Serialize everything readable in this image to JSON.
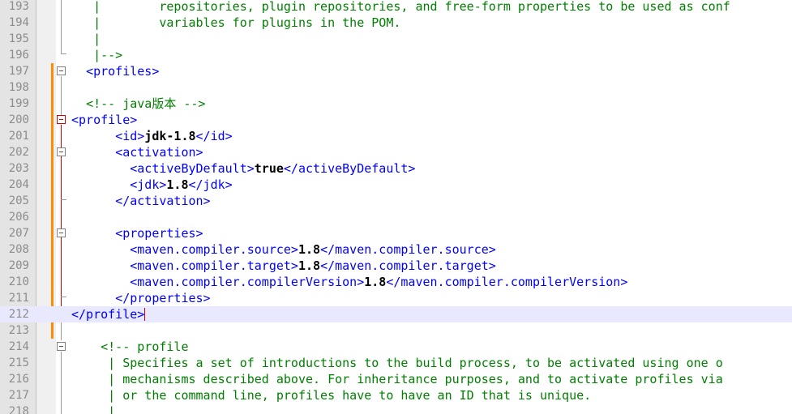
{
  "editor": {
    "lines": [
      {
        "n": "193",
        "segs": [
          {
            "t": "   |        ",
            "c": "cmt"
          },
          {
            "t": "repositories, plugin repositories, and free-form properties to be used as conf",
            "c": "cmt"
          }
        ]
      },
      {
        "n": "194",
        "segs": [
          {
            "t": "   |        ",
            "c": "cmt"
          },
          {
            "t": "variables for plugins in the POM.",
            "c": "cmt"
          }
        ]
      },
      {
        "n": "195",
        "segs": [
          {
            "t": "   |",
            "c": "cmt"
          }
        ]
      },
      {
        "n": "196",
        "segs": [
          {
            "t": "   |-->",
            "c": "cmt"
          }
        ]
      },
      {
        "n": "197",
        "segs": [
          {
            "t": "  ",
            "c": ""
          },
          {
            "t": "<profiles>",
            "c": "tag"
          }
        ]
      },
      {
        "n": "198",
        "segs": []
      },
      {
        "n": "199",
        "segs": [
          {
            "t": "  ",
            "c": ""
          },
          {
            "t": "<!-- java版本 -->",
            "c": "cmt"
          }
        ]
      },
      {
        "n": "200",
        "segs": [
          {
            "t": "<profile>",
            "c": "tag"
          }
        ]
      },
      {
        "n": "201",
        "segs": [
          {
            "t": "      ",
            "c": ""
          },
          {
            "t": "<id>",
            "c": "tag"
          },
          {
            "t": "jdk-1.8",
            "c": "txt"
          },
          {
            "t": "</id>",
            "c": "tag"
          }
        ]
      },
      {
        "n": "202",
        "segs": [
          {
            "t": "      ",
            "c": ""
          },
          {
            "t": "<activation>",
            "c": "tag"
          }
        ]
      },
      {
        "n": "203",
        "segs": [
          {
            "t": "        ",
            "c": ""
          },
          {
            "t": "<activeByDefault>",
            "c": "tag"
          },
          {
            "t": "true",
            "c": "txt"
          },
          {
            "t": "</activeByDefault>",
            "c": "tag"
          }
        ]
      },
      {
        "n": "204",
        "segs": [
          {
            "t": "        ",
            "c": ""
          },
          {
            "t": "<jdk>",
            "c": "tag"
          },
          {
            "t": "1.8",
            "c": "txt"
          },
          {
            "t": "</jdk>",
            "c": "tag"
          }
        ]
      },
      {
        "n": "205",
        "segs": [
          {
            "t": "      ",
            "c": ""
          },
          {
            "t": "</activation>",
            "c": "tag"
          }
        ]
      },
      {
        "n": "206",
        "segs": []
      },
      {
        "n": "207",
        "segs": [
          {
            "t": "      ",
            "c": ""
          },
          {
            "t": "<properties>",
            "c": "tag"
          }
        ]
      },
      {
        "n": "208",
        "segs": [
          {
            "t": "        ",
            "c": ""
          },
          {
            "t": "<maven.compiler.source>",
            "c": "tag"
          },
          {
            "t": "1.8",
            "c": "txt"
          },
          {
            "t": "</maven.compiler.source>",
            "c": "tag"
          }
        ]
      },
      {
        "n": "209",
        "segs": [
          {
            "t": "        ",
            "c": ""
          },
          {
            "t": "<maven.compiler.target>",
            "c": "tag"
          },
          {
            "t": "1.8",
            "c": "txt"
          },
          {
            "t": "</maven.compiler.target>",
            "c": "tag"
          }
        ]
      },
      {
        "n": "210",
        "segs": [
          {
            "t": "        ",
            "c": ""
          },
          {
            "t": "<maven.compiler.compilerVersion>",
            "c": "tag"
          },
          {
            "t": "1.8",
            "c": "txt"
          },
          {
            "t": "</maven.compiler.compilerVersion>",
            "c": "tag"
          }
        ]
      },
      {
        "n": "211",
        "segs": [
          {
            "t": "      ",
            "c": ""
          },
          {
            "t": "</properties>",
            "c": "tag"
          }
        ]
      },
      {
        "n": "212",
        "segs": [
          {
            "t": "</profile>",
            "c": "tag"
          }
        ],
        "current": true
      },
      {
        "n": "213",
        "segs": []
      },
      {
        "n": "214",
        "segs": [
          {
            "t": "    ",
            "c": ""
          },
          {
            "t": "<!-- profile",
            "c": "cmt"
          }
        ]
      },
      {
        "n": "215",
        "segs": [
          {
            "t": "     | Specifies a set of introductions to the build process, to be activated using one o",
            "c": "cmt"
          }
        ]
      },
      {
        "n": "216",
        "segs": [
          {
            "t": "     | mechanisms described above. For inheritance purposes, and to activate profiles via",
            "c": "cmt"
          }
        ]
      },
      {
        "n": "217",
        "segs": [
          {
            "t": "     | or the command line, profiles have to have an ID that is unique.",
            "c": "cmt"
          }
        ]
      },
      {
        "n": "218",
        "segs": [
          {
            "t": "     |",
            "c": "cmt"
          }
        ]
      }
    ]
  },
  "colors": {
    "tag": "#0000ff",
    "comment": "#008000",
    "text": "#000000",
    "line_number": "#8c8c8c",
    "change_bar": "#ff8c00",
    "fold_active": "#d40000",
    "current_line": "#e8e8ff"
  }
}
